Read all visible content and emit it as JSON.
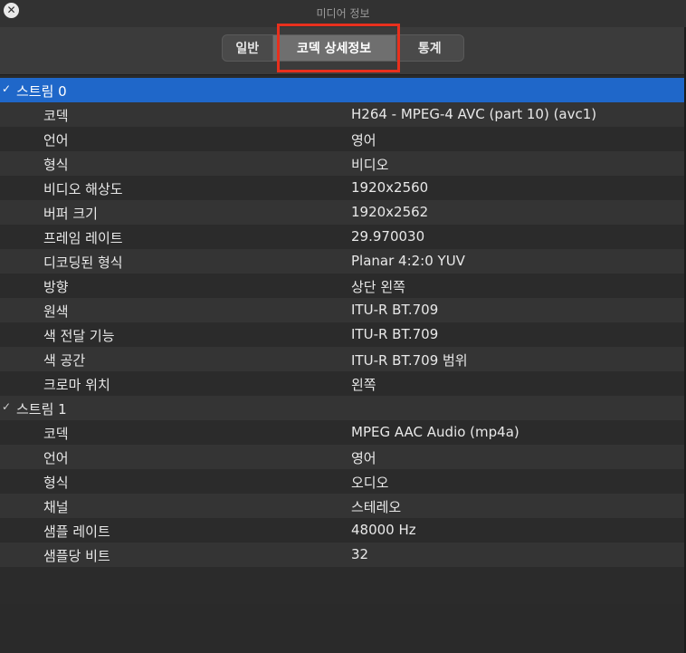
{
  "window": {
    "title": "미디어 정보"
  },
  "tabs": [
    {
      "label": "일반"
    },
    {
      "label": "코덱 상세정보"
    },
    {
      "label": "통계"
    }
  ],
  "streams": [
    {
      "name": "스트림 0",
      "rows": [
        {
          "key": "코덱",
          "value": "H264 - MPEG-4 AVC (part 10) (avc1)"
        },
        {
          "key": "언어",
          "value": "영어"
        },
        {
          "key": "형식",
          "value": "비디오"
        },
        {
          "key": "비디오 해상도",
          "value": "1920x2560"
        },
        {
          "key": "버퍼 크기",
          "value": "1920x2562"
        },
        {
          "key": "프레임 레이트",
          "value": "29.970030"
        },
        {
          "key": "디코딩된 형식",
          "value": "Planar 4:2:0 YUV"
        },
        {
          "key": "방향",
          "value": "상단 왼쪽"
        },
        {
          "key": "원색",
          "value": "ITU-R BT.709"
        },
        {
          "key": "색 전달 기능",
          "value": "ITU-R BT.709"
        },
        {
          "key": "색 공간",
          "value": "ITU-R BT.709 범위"
        },
        {
          "key": "크로마 위치",
          "value": "왼쪽"
        }
      ]
    },
    {
      "name": "스트림 1",
      "rows": [
        {
          "key": "코덱",
          "value": "MPEG AAC Audio (mp4a)"
        },
        {
          "key": "언어",
          "value": "영어"
        },
        {
          "key": "형식",
          "value": "오디오"
        },
        {
          "key": "채널",
          "value": "스테레오"
        },
        {
          "key": "샘플 레이트",
          "value": "48000 Hz"
        },
        {
          "key": "샘플당 비트",
          "value": "32"
        }
      ]
    }
  ],
  "colors": {
    "selection": "#1f67c9",
    "highlight_box": "#e8301d"
  },
  "icons": {
    "close": "close-icon",
    "disclosure": "chevron-down-icon"
  }
}
